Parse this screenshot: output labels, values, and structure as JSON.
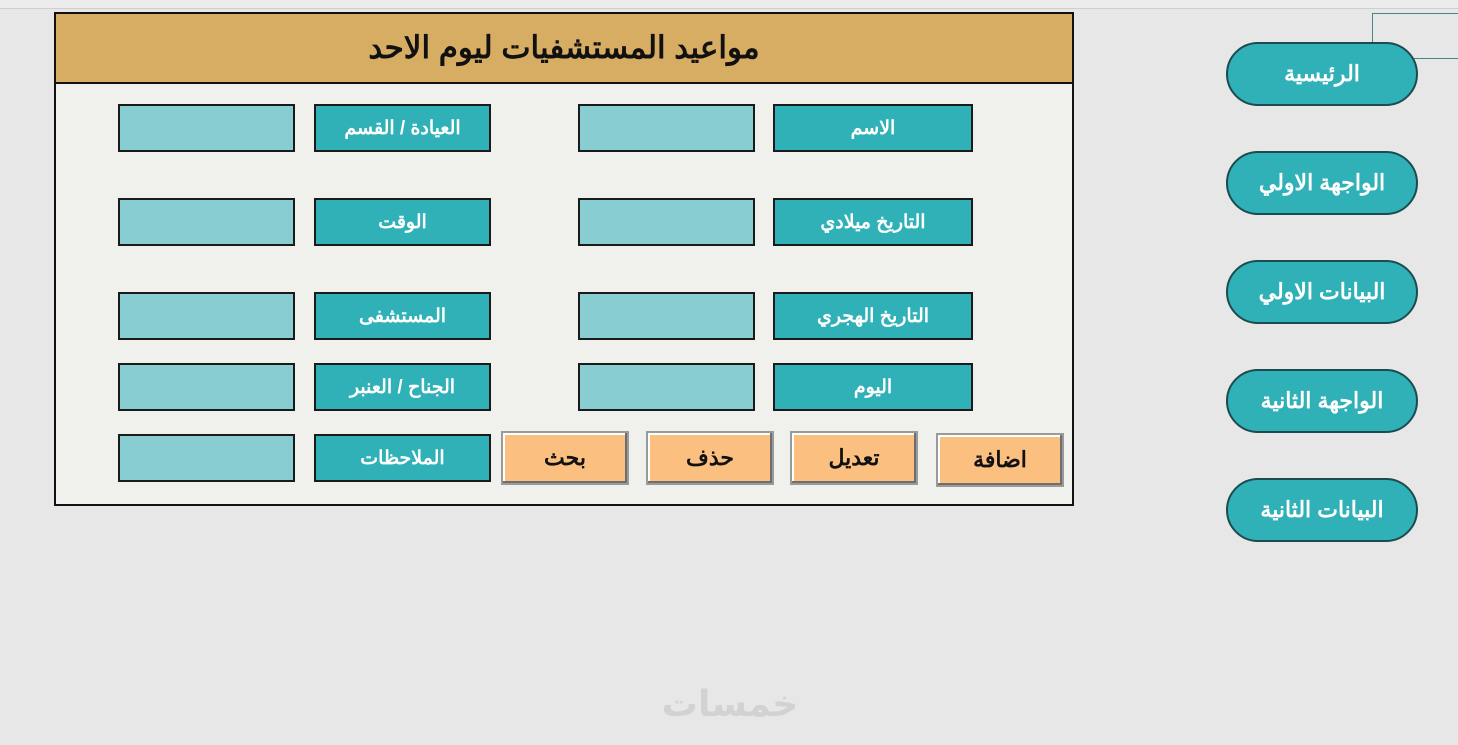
{
  "form": {
    "title": "مواعيد المستشفيات ليوم الاحد",
    "labels": {
      "name": "الاسم",
      "clinic": "العيادة / القسم",
      "gregorian_date": "التاريخ ميلادي",
      "time": "الوقت",
      "hijri_date": "التاريخ الهجري",
      "hospital": "المستشفى",
      "day": "اليوم",
      "ward": "الجناح / العنبر",
      "notes": "الملاحظات"
    },
    "values": {
      "name": "",
      "clinic": "",
      "gregorian_date": "",
      "time": "",
      "hijri_date": "",
      "hospital": "",
      "day": "",
      "ward": "",
      "notes": ""
    },
    "actions": {
      "add": "اضافة",
      "edit": "تعديل",
      "delete": "حذف",
      "search": "بحث"
    }
  },
  "nav": {
    "items": [
      {
        "label": "الرئيسية"
      },
      {
        "label": "الواجهة الاولي"
      },
      {
        "label": "البيانات الاولي"
      },
      {
        "label": "الواجهة الثانية"
      },
      {
        "label": "البيانات الثانية"
      }
    ]
  },
  "watermark": "خمسات",
  "colors": {
    "title_bar": "#d6ad62",
    "label_fill": "#2fb1b7",
    "field_fill": "#88cdd1",
    "action_fill": "#fbbf80",
    "panel_bg": "#f0f0ec",
    "page_bg": "#e7e7e7"
  }
}
